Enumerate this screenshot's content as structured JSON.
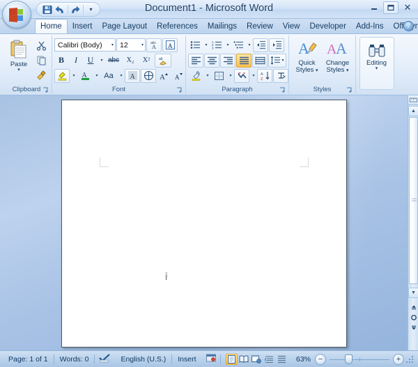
{
  "window": {
    "title": "Document1 - Microsoft Word",
    "minimize_label": "–",
    "maximize_label": "❒",
    "close_label": "✕"
  },
  "office_button": {
    "name": "Office Button"
  },
  "quick_access": {
    "items": [
      {
        "label": "Save",
        "icon": "save-icon"
      },
      {
        "label": "Undo",
        "icon": "undo-icon"
      },
      {
        "label": "Redo",
        "icon": "redo-icon"
      }
    ],
    "customize_label": "▾"
  },
  "tabs": [
    {
      "label": "Home",
      "active": true
    },
    {
      "label": "Insert",
      "active": false
    },
    {
      "label": "Page Layout",
      "active": false
    },
    {
      "label": "References",
      "active": false
    },
    {
      "label": "Mailings",
      "active": false
    },
    {
      "label": "Review",
      "active": false
    },
    {
      "label": "View",
      "active": false
    },
    {
      "label": "Developer",
      "active": false
    },
    {
      "label": "Add-Ins",
      "active": false
    },
    {
      "label": "OffiSync (Beta)",
      "active": false
    }
  ],
  "help_label": "?",
  "ribbon": {
    "clipboard": {
      "group_label": "Clipboard",
      "paste_label": "Paste",
      "paste_caret": "▾",
      "cut_label": "Cut",
      "copy_label": "Copy",
      "format_painter_label": "Format Painter",
      "launcher_label": "⤵"
    },
    "font": {
      "group_label": "Font",
      "font_name_value": "Calibri (Body)",
      "font_size_value": "12",
      "dropdown_caret": "▾",
      "phonetic_guide_label": "Phonetic Guide",
      "character_border_label": "Character Border",
      "bold_label": "B",
      "italic_label": "I",
      "underline_label": "U",
      "strikethrough_label": "abc",
      "subscript_label": "X₂",
      "superscript_label": "X²",
      "clear_formatting_label": "Clear Formatting",
      "highlight_label": "Text Highlight Color",
      "font_color_label": "A",
      "change_case_label": "Aa",
      "character_shading_label": "A",
      "enclose_characters_label": "Enclose Characters",
      "grow_font_label": "A",
      "shrink_font_label": "A",
      "launcher_label": "⤵"
    },
    "paragraph": {
      "group_label": "Paragraph",
      "bullets_label": "Bullets",
      "numbering_label": "Numbering",
      "multilevel_label": "Multilevel List",
      "decrease_indent_label": "Decrease Indent",
      "increase_indent_label": "Increase Indent",
      "align_left_label": "Align Left",
      "align_center_label": "Center",
      "align_right_label": "Align Right",
      "justify_label": "Justify",
      "distributed_label": "Distributed",
      "line_spacing_label": "Line Spacing",
      "shading_label": "Shading",
      "borders_label": "Borders",
      "show_marks_label": "Show/Hide",
      "sort_label": "Sort",
      "asian_layout_label": "Asian Layout",
      "dropdown_caret": "▾",
      "launcher_label": "⤵"
    },
    "styles": {
      "group_label": "Styles",
      "quick_styles_line1": "Quick",
      "quick_styles_line2": "Styles",
      "change_styles_line1": "Change",
      "change_styles_line2": "Styles",
      "caret": "▾",
      "launcher_label": "⤵"
    },
    "editing": {
      "group_label": "",
      "editing_label": "Editing",
      "caret": "▾"
    }
  },
  "document": {
    "page_background": "#ffffff",
    "paragraph_mark": "¶"
  },
  "scrollbar": {
    "up_arrow": "▲",
    "down_arrow": "▼",
    "previous_page_label": "⤒",
    "select_browse_object_label": "○",
    "next_page_label": "⤓",
    "ruler_toggle_label": "Ruler"
  },
  "status_bar": {
    "page_label": "Page: 1 of 1",
    "words_label": "Words: 0",
    "proofing_icon_label": "Proofing Errors",
    "language_label": "English (U.S.)",
    "insert_label": "Insert",
    "macro_icon_label": "Record Macro",
    "views": [
      {
        "name": "print-layout",
        "label": "Print Layout",
        "active": true
      },
      {
        "name": "full-screen-reading",
        "label": "Full Screen Reading",
        "active": false
      },
      {
        "name": "web-layout",
        "label": "Web Layout",
        "active": false
      },
      {
        "name": "outline",
        "label": "Outline",
        "active": false
      },
      {
        "name": "draft",
        "label": "Draft",
        "active": false
      }
    ],
    "zoom_value": "63%",
    "zoom_out_label": "−",
    "zoom_in_label": "+"
  },
  "colors": {
    "accent": "#1b3c63",
    "highlight": "#fbbf4e",
    "title_text": "#1f3f63",
    "ribbon_bg": "#e4eefa"
  }
}
